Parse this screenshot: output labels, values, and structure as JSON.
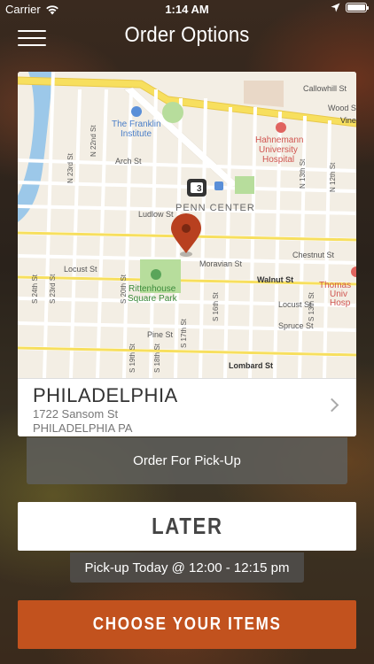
{
  "status_bar": {
    "carrier": "Carrier",
    "time": "1:14 AM",
    "icons": [
      "wifi-icon",
      "location-arrow-icon",
      "battery-icon"
    ],
    "battery_level": 1.0
  },
  "header": {
    "title": "Order Options",
    "menu_icon": "hamburger-menu-icon"
  },
  "map": {
    "streets": {
      "vine": "Vine",
      "callowhill": "Callowhill St",
      "wood": "Wood St",
      "arch": "Arch St",
      "ludlow": "Ludlow St",
      "chestnut": "Chestnut St",
      "moravian": "Moravian St",
      "locust_left": "Locust St",
      "locust_right": "Locust St",
      "walnut": "Walnut St",
      "spruce": "Spruce St",
      "pine": "Pine St",
      "lombard": "Lombard St",
      "n22": "N 22nd St",
      "n23": "N 23rd St",
      "n13": "N 13th St",
      "n12": "N 12th St",
      "s24": "S 24th St",
      "s23": "S 23rd St",
      "s20": "S 20th St",
      "s19": "S 19th St",
      "s18": "S 18th St",
      "s17": "S 17th St",
      "s16": "S 16th St",
      "s13": "S 13th St"
    },
    "pois": {
      "franklin_1": "The Franklin",
      "franklin_2": "Institute",
      "hahnemann_1": "Hahnemann",
      "hahnemann_2": "University",
      "hahnemann_3": "Hospital",
      "penn_center": "PENN CENTER",
      "rittenhouse_1": "Rittenhouse",
      "rittenhouse_2": "Square Park",
      "thomas_1": "Thomas",
      "thomas_2": "Univ",
      "thomas_3": "Hosp",
      "route_shield": "3"
    },
    "colors": {
      "land": "#f3eee4",
      "highway": "#f7df5e",
      "river": "#9cc8e9",
      "park": "#b7dd9c",
      "pin": "#b8401f"
    }
  },
  "location": {
    "city": "PHILADELPHIA",
    "street": "1722 Sansom St",
    "city_state": "PHILADELPHIA PA"
  },
  "buttons": {
    "pickup": "Order For Pick-Up",
    "later": "LATER",
    "choose": "CHOOSE YOUR ITEMS"
  },
  "pickup_time": "Pick-up Today @ 12:00 - 12:15 pm",
  "colors": {
    "accent": "#c2521e",
    "pill_bg": "#5f5f5c"
  }
}
